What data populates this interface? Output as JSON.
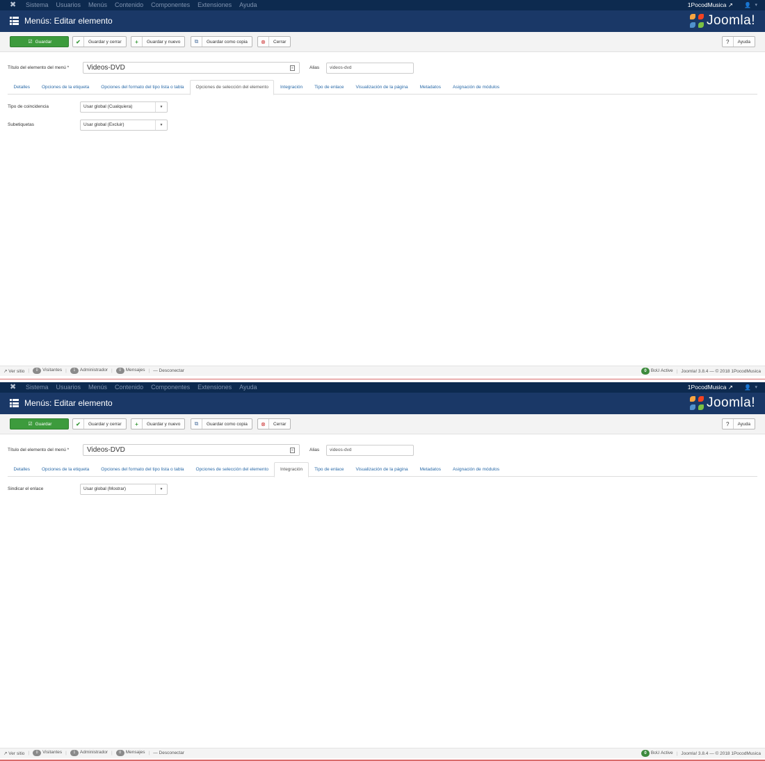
{
  "navbar": {
    "items": [
      "Sistema",
      "Usuarios",
      "Menús",
      "Contenido",
      "Componentes",
      "Extensiones",
      "Ayuda"
    ],
    "site_name": "1PocodMusica"
  },
  "header": {
    "title": "Menús: Editar elemento",
    "brand": "Joomla!"
  },
  "toolbar": {
    "save_label": "Guardar",
    "save_close_label": "Guardar y cerrar",
    "save_new_label": "Guardar y nuevo",
    "save_copy_label": "Guardar como copia",
    "close_label": "Cerrar",
    "help_label": "Ayuda"
  },
  "form": {
    "title_label": "Título del elemento del menú *",
    "title_value": "Videos-DVD",
    "alias_label": "Alias",
    "alias_value": "videos-dvd"
  },
  "tabs": [
    "Detalles",
    "Opciones de la etiqueta",
    "Opciones del formato del tipo lista o tabla",
    "Opciones de selección del elemento",
    "Integración",
    "Tipo de enlace",
    "Visualización de la página",
    "Metadatos",
    "Asignación de módulos"
  ],
  "screen_a": {
    "active_tab": "Opciones de selección del elemento",
    "fields": [
      {
        "label": "Tipo de coincidencia",
        "value": "Usar global (Cualquiera)"
      },
      {
        "label": "Subetiquetas",
        "value": "Usar global (Excluir)"
      }
    ]
  },
  "screen_b": {
    "active_tab": "Integración",
    "fields": [
      {
        "label": "Sindicar el enlace",
        "value": "Usar global (Mostrar)"
      }
    ]
  },
  "statusbar": {
    "view_site": "Ver sitio",
    "visitors_count": "0",
    "visitors": "Visitantes",
    "admin_count": "1",
    "admin": "Administrador",
    "messages_count": "0",
    "messages": "Mensajes",
    "logout": "Desconectar",
    "bou_badge": "0",
    "bou": "BoU Active",
    "version": "Joomla! 3.8.4 — © 2018 1PocodMusica"
  },
  "colors": {
    "navbar": "#0d2a4f",
    "titlebar": "#1a3867",
    "save_button": "#3d9b3d",
    "link": "#2a6aa8"
  }
}
